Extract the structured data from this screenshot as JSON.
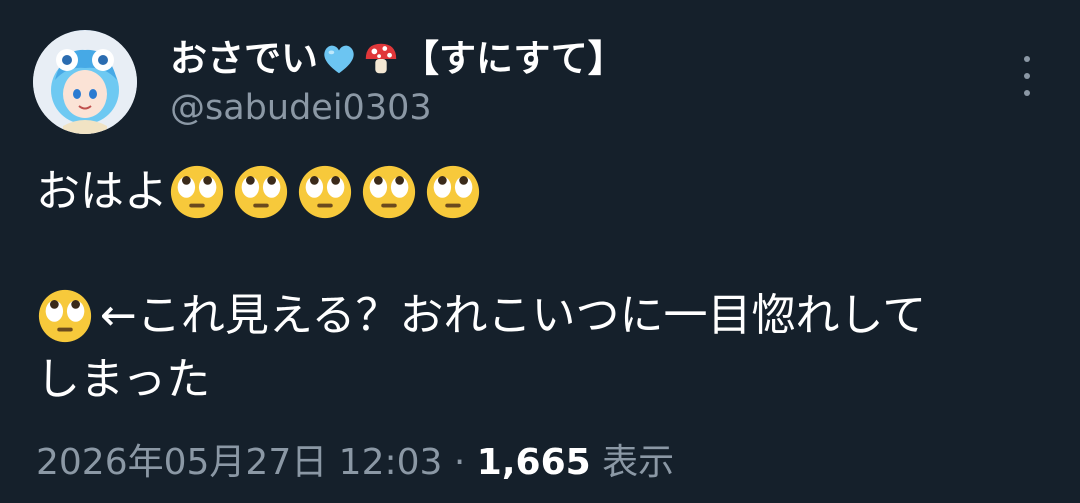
{
  "tweet": {
    "display_name_prefix": "おさでい",
    "display_name_suffix": "【すにすて】",
    "name_emojis": [
      "light-blue-heart-icon",
      "mushroom-icon"
    ],
    "handle": "@sabudei0303",
    "line1_text": "おはよ",
    "line1_emoji_count": 5,
    "line2_text": "←これ見える？おれこいつに一目惚れして",
    "line3_text": "しまった",
    "timestamp": "2026年05月27日 12:03",
    "separator": "·",
    "views_count": "1,665",
    "views_label": "表示",
    "colors": {
      "background": "#15202b",
      "secondary_text": "#8b98a5",
      "primary_text": "#ffffff"
    }
  }
}
